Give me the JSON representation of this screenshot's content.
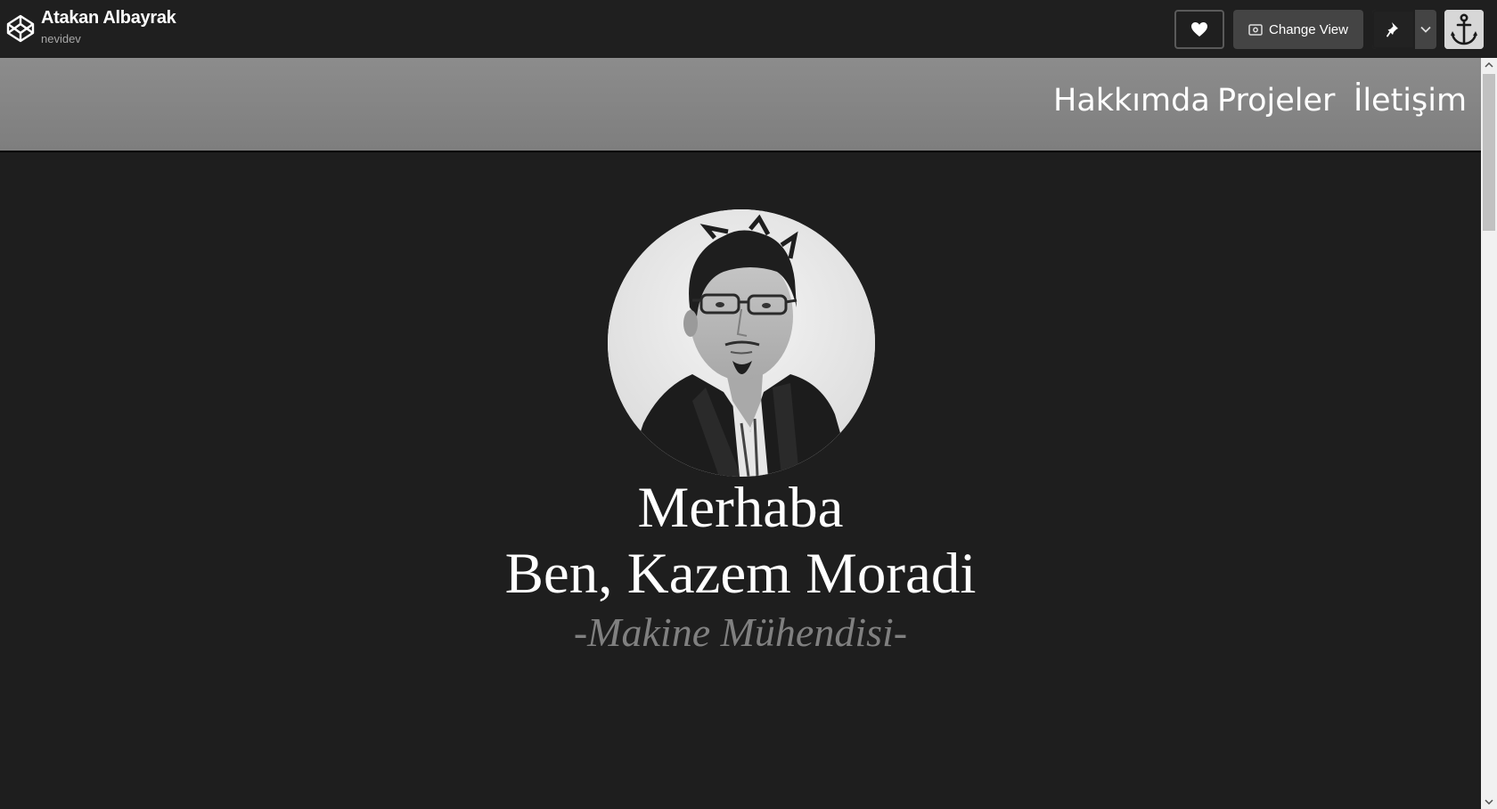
{
  "topbar": {
    "title": "Atakan Albayrak",
    "username": "nevidev",
    "change_view_label": "Change View",
    "icons": {
      "logo": "codepen-logo-icon",
      "heart": "heart-icon",
      "change_view": "eye-icon",
      "pin": "pin-icon",
      "dropdown": "chevron-down-icon"
    }
  },
  "nav": {
    "links": [
      "Hakkımda",
      "Projeler",
      "İletişim"
    ]
  },
  "hero": {
    "line1": "Merhaba",
    "line2": "Ben, Kazem Moradi",
    "subtitle": "-Makine Mühendisi-"
  },
  "colors": {
    "topbar_bg": "#1f1f1f",
    "page_bg": "#1e1e1e",
    "navbar_bg": "#858585",
    "subtitle": "#808080"
  }
}
